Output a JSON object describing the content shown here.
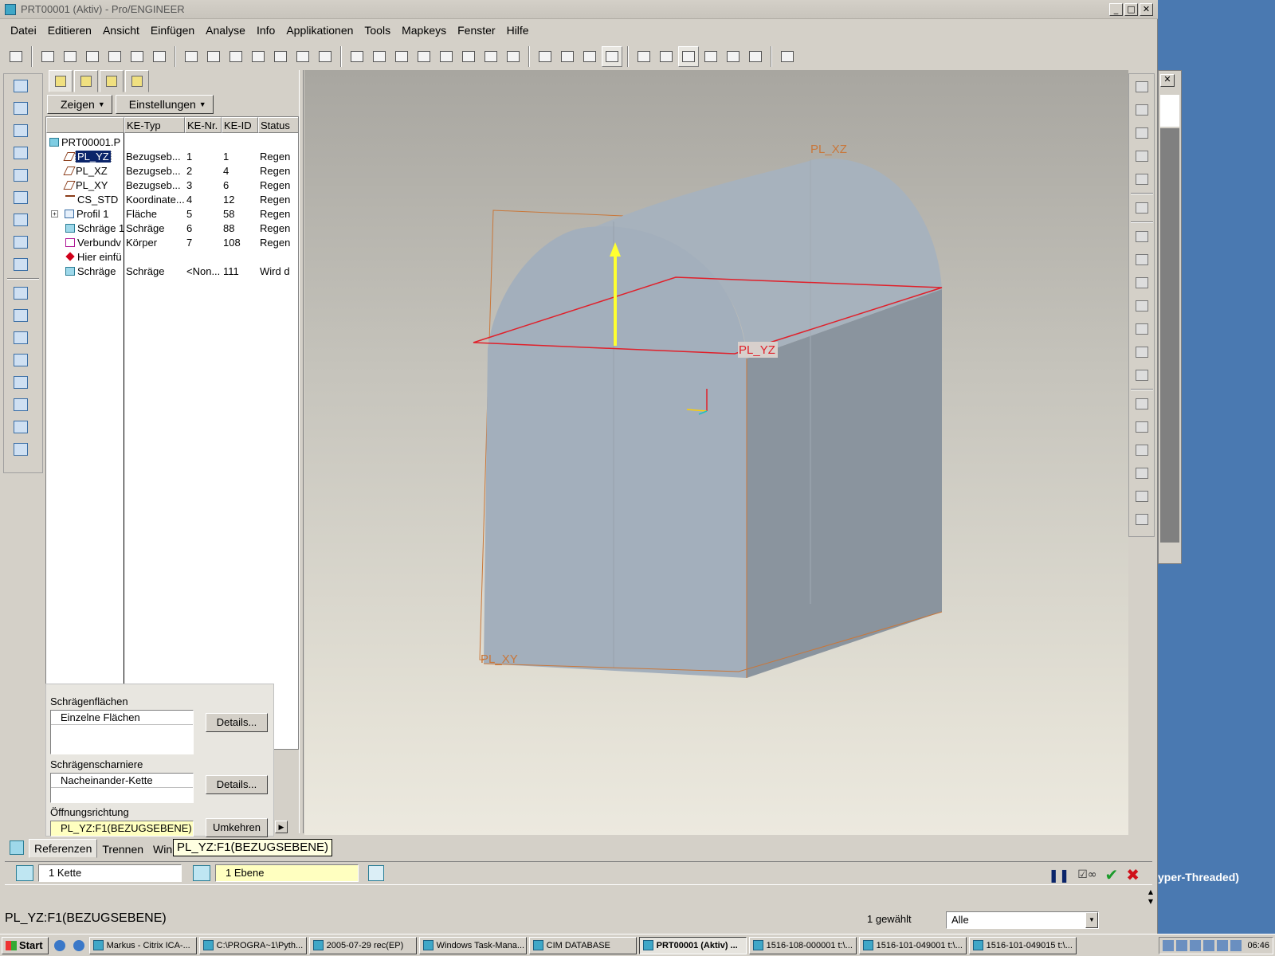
{
  "window": {
    "title": "PRT00001 (Aktiv) - Pro/ENGINEER"
  },
  "menu": [
    "Datei",
    "Editieren",
    "Ansicht",
    "Einfügen",
    "Analyse",
    "Info",
    "Applikationen",
    "Tools",
    "Mapkeys",
    "Fenster",
    "Hilfe"
  ],
  "tree_panel": {
    "show_button": "Zeigen",
    "settings_button": "Einstellungen",
    "columns": [
      "KE-Typ",
      "KE-Nr.",
      "KE-ID",
      "Status"
    ],
    "root": "PRT00001.P",
    "rows": [
      {
        "name": "PL_YZ",
        "icon": "datum-plane-icon",
        "type": "Bezugseb...",
        "nr": "1",
        "id": "1",
        "status": "Regen"
      },
      {
        "name": "PL_XZ",
        "icon": "datum-plane-icon",
        "type": "Bezugseb...",
        "nr": "2",
        "id": "4",
        "status": "Regen"
      },
      {
        "name": "PL_XY",
        "icon": "datum-plane-icon",
        "type": "Bezugseb...",
        "nr": "3",
        "id": "6",
        "status": "Regen"
      },
      {
        "name": "CS_STD",
        "icon": "coordinate-system-icon",
        "type": "Koordinate...",
        "nr": "4",
        "id": "12",
        "status": "Regen"
      },
      {
        "name": "Profil 1",
        "icon": "sketch-icon",
        "type": "Fläche",
        "nr": "5",
        "id": "58",
        "status": "Regen"
      },
      {
        "name": "Schräge 1",
        "icon": "draft-icon",
        "type": "Schräge",
        "nr": "6",
        "id": "88",
        "status": "Regen"
      },
      {
        "name": "Verbundv",
        "icon": "blend-icon",
        "type": "Körper",
        "nr": "7",
        "id": "108",
        "status": "Regen"
      },
      {
        "name": "Hier einfü",
        "icon": "insert-here-icon",
        "type": "",
        "nr": "",
        "id": "",
        "status": ""
      },
      {
        "name": "Schräge",
        "icon": "draft-icon",
        "type": "Schräge",
        "nr": "<Non...",
        "id": "111",
        "status": "Wird d"
      }
    ]
  },
  "dashboard_panel": {
    "draft_surfaces_label": "Schrägenflächen",
    "draft_surfaces_value": "Einzelne Flächen",
    "details_button": "Details...",
    "draft_hinges_label": "Schrägenscharniere",
    "draft_hinges_value": "Nacheinander-Kette",
    "pull_direction_label": "Öffnungsrichtung",
    "pull_direction_value": "PL_YZ:F1(BEZUGSEBENE)",
    "flip_button": "Umkehren"
  },
  "dashboard_tabs": [
    "Referenzen",
    "Trennen",
    "Winke"
  ],
  "tooltip": "PL_YZ:F1(BEZUGSEBENE)",
  "dashboard_row": {
    "chain_field": "1 Kette",
    "plane_field": "1 Ebene"
  },
  "viewport_labels": {
    "pl_xz": "PL_XZ",
    "pl_yz": "PL_YZ",
    "pl_xy": "PL_XY"
  },
  "status": {
    "message": "PL_YZ:F1(BEZUGSEBENE)",
    "selected_count": "1 gewählt",
    "filter": "Alle"
  },
  "background_text": "yper-Threaded)",
  "taskbar": {
    "start": "Start",
    "tasks": [
      {
        "label": "Markus - Citrix ICA-...",
        "active": false
      },
      {
        "label": "C:\\PROGRA~1\\Pyth...",
        "active": false
      },
      {
        "label": "2005-07-29 rec(EP)",
        "active": false
      },
      {
        "label": "Windows Task-Mana...",
        "active": false
      },
      {
        "label": "CIM DATABASE",
        "active": false
      },
      {
        "label": "PRT00001 (Aktiv) ...",
        "active": true
      },
      {
        "label": "1516-108-000001 t:\\...",
        "active": false
      },
      {
        "label": "1516-101-049001 t:\\...",
        "active": false
      },
      {
        "label": "1516-101-049015 t:\\...",
        "active": false
      }
    ],
    "clock": "06:46"
  },
  "colors": {
    "model_face": "#a3afbc",
    "model_side": "#8a949e",
    "datum_plane": "#c9773a",
    "selected_plane": "#e0202a",
    "direction_arrow": "#ffff30",
    "desktop": "#4a79b1"
  }
}
